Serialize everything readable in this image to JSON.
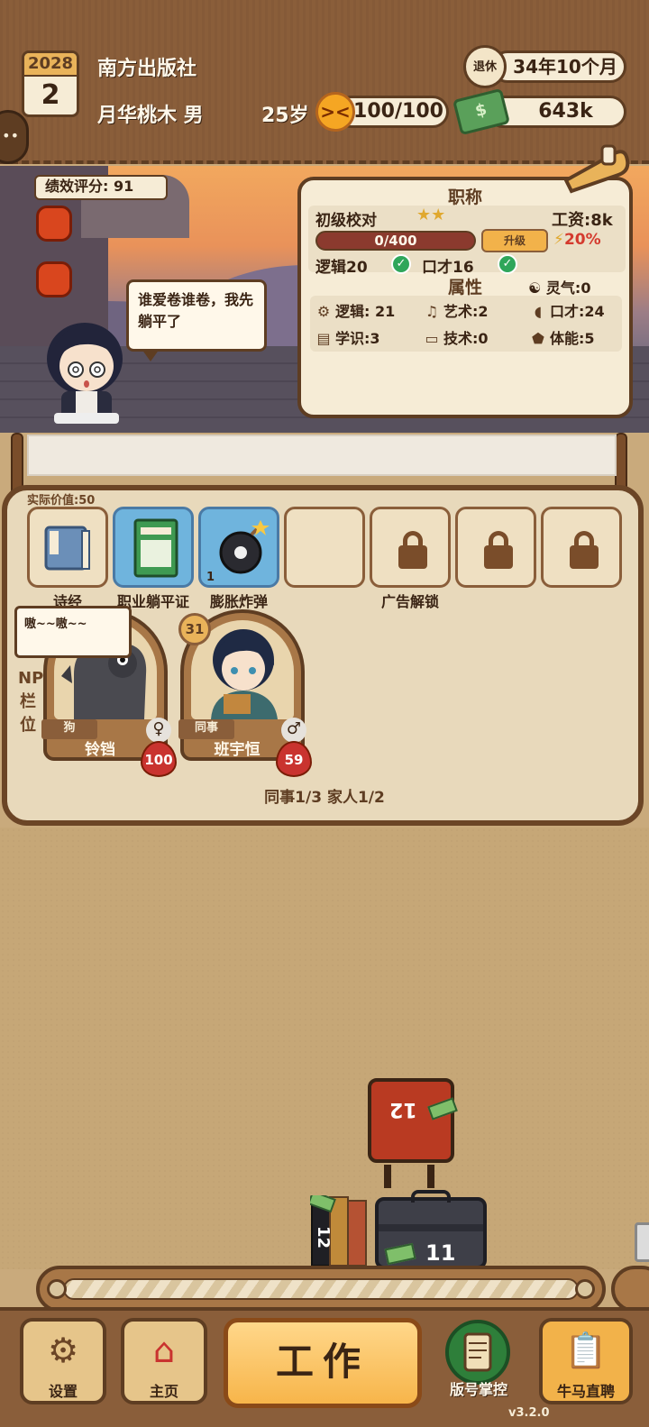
{
  "header": {
    "year": "2028",
    "day": "2",
    "company": "南方出版社",
    "player": "月华桃木 男",
    "age": "25岁",
    "hp": "100/100",
    "retire_label": "退休",
    "retire_time": "34年10个月",
    "money": "643k"
  },
  "scene": {
    "performance": "绩效评分: 91",
    "speech": "谁爱卷谁卷，我先躺平了"
  },
  "job": {
    "title_header": "职称",
    "title": "初级校对",
    "stars": "★★",
    "salary": "工资:8k",
    "xp": "0/400",
    "upgrade_label": "升级",
    "bonus": "20%",
    "req_logic": "逻辑20",
    "req_speech": "口才16",
    "attr_header": "属性",
    "spirit": "灵气:0",
    "attrs": {
      "logic": "逻辑: 21",
      "art": "艺术:2",
      "speech": "口才:24",
      "knowledge": "学识:3",
      "tech": "技术:0",
      "stamina": "体能:5"
    }
  },
  "inventory": {
    "value_label": "实际价值:50",
    "items": [
      {
        "label": "诗经"
      },
      {
        "label": "职业躺平证"
      },
      {
        "label": "膨胀炸弹",
        "count": "1"
      }
    ],
    "ad_unlock": "广告解锁"
  },
  "npcs": {
    "side_label": "NPC栏位",
    "speech": "嗷~~嗷~~",
    "list": [
      {
        "tag": "狗",
        "name": "铃铛",
        "gender": "♀",
        "favor": "100"
      },
      {
        "tag": "同事",
        "name": "班宇恒",
        "gender": "♂",
        "favor": "59",
        "level": "31"
      }
    ],
    "count": "同事1/3 家人1/2"
  },
  "board": {
    "red_case": "12",
    "books": "12",
    "dark_case": "11"
  },
  "nav": {
    "settings": "设置",
    "home": "主页",
    "work": "工作",
    "account": "版号掌控",
    "hire": "牛马直聘",
    "version": "v3.2.0"
  },
  "colors": {
    "wood_dark": "#5e3d22",
    "wood": "#8a5e3a",
    "paper": "#f6ecd6",
    "accent_orange": "#f7b54a",
    "bonus_red": "#d43a2e"
  }
}
